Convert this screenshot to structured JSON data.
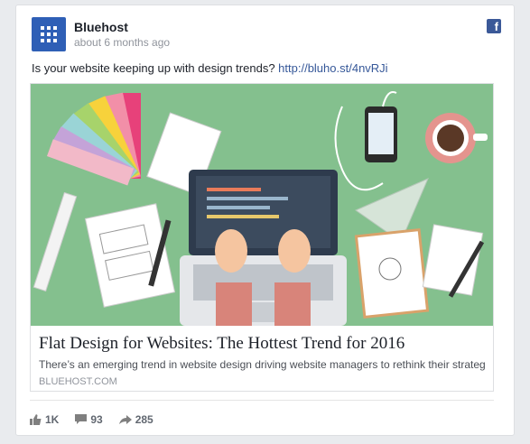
{
  "post": {
    "page_name": "Bluehost",
    "time": "about 6 months ago",
    "text": "Is your website keeping up with design trends?",
    "link_text": "http://bluho.st/4nvRJi"
  },
  "link_preview": {
    "title": "Flat Design for Websites: The Hottest Trend for 2016",
    "description": "There’s an emerging trend in website design driving website managers to rethink their strategies. Ma...",
    "domain": "BLUEHOST.COM"
  },
  "stats": {
    "likes": "1K",
    "comments": "93",
    "shares": "285"
  },
  "icons": {
    "avatar": "bluehost-logo-icon",
    "network": "facebook-icon",
    "like": "thumbs-up-icon",
    "comment": "comment-icon",
    "share": "share-arrow-icon"
  },
  "colors": {
    "brand": "#2f5fb6",
    "facebook": "#3b5998",
    "link": "#365899",
    "hero_background": "#84c08e"
  }
}
